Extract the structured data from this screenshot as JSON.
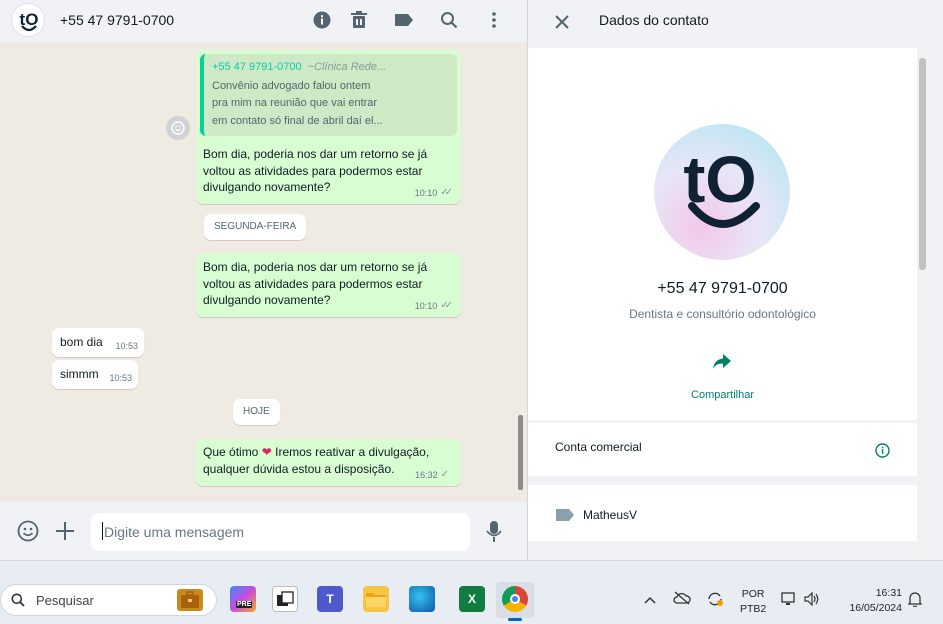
{
  "chat": {
    "header": {
      "title": "+55 47 9791-0700"
    },
    "messages": {
      "quoted_name": "+55 47 9791-0700",
      "quoted_sub": "~Clínica Rede...",
      "quoted_lines": [
        "Convênio advogado falou ontem",
        "pra mim na reunião que vai entrar",
        "em contato só final de abril daí el..."
      ],
      "m1_lines": [
        "Bom dia, poderia nos dar um retorno se já",
        "voltou as atividades para podermos estar",
        "divulgando novamente?"
      ],
      "m1_time": "10:10",
      "day1": "SEGUNDA-FEIRA",
      "m2_lines": [
        "Bom dia, poderia nos dar um retorno se já",
        "voltou as atividades para podermos estar",
        "divulgando novamente?"
      ],
      "m2_time": "10:10",
      "in1_text": "bom dia",
      "in1_time": "10:53",
      "in2_text": "simmm",
      "in2_time": "10:53",
      "day2": "HOJE",
      "m3_line1_pre": "Que ótimo",
      "m3_line1_post": "Iremos reativar a divulgação,",
      "m3_line2": "qualquer dúvida estou a disposição.",
      "m3_time": "16:32"
    },
    "composer": {
      "placeholder": "Digite uma mensagem"
    }
  },
  "panel": {
    "title": "Dados do contato",
    "phone": "+55 47 9791-0700",
    "description": "Dentista e consultório odontológico",
    "share_label": "Compartilhar",
    "business_label": "Conta comercial",
    "tag_label": "MatheusV",
    "logo_text": "tO"
  },
  "taskbar": {
    "search_placeholder": "Pesquisar",
    "lang_line1": "POR",
    "lang_line2": "PTB2",
    "time": "16:31",
    "date": "16/05/2024",
    "copilot_badge": "PRE"
  },
  "colors": {
    "accent": "#008069",
    "outgoing_bubble": "#d9fdd3",
    "brand_navy": "#0f2233"
  }
}
